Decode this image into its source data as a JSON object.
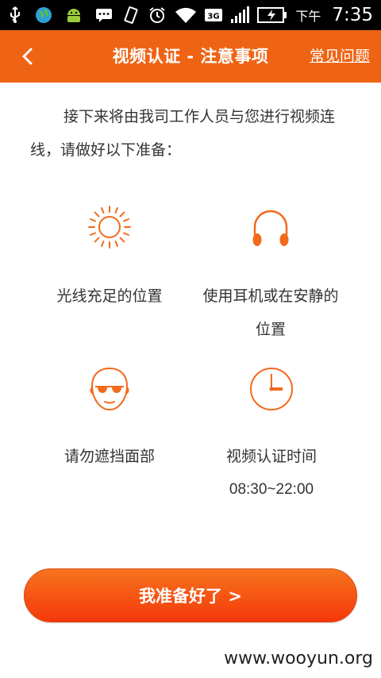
{
  "status_bar": {
    "icons": [
      "usb-icon",
      "globe-icon",
      "android-icon",
      "message-icon",
      "vibrate-icon",
      "alarm-icon",
      "wifi-icon",
      "network-3g-icon",
      "signal-icon",
      "battery-charging-icon"
    ],
    "network_label": "3G",
    "ampm": "下午",
    "time": "7:35"
  },
  "header": {
    "title": "视频认证 - 注意事项",
    "back_label": "<",
    "faq_label": "常见问题",
    "bg_color": "#ef6414"
  },
  "intro": {
    "text": "接下来将由我司工作人员与您进行视频连线，请做好以下准备："
  },
  "tips": [
    {
      "icon": "sun-icon",
      "label": "光线充足的位置",
      "sub": ""
    },
    {
      "icon": "headphones-icon",
      "label": "使用耳机或在安静的",
      "sub": "位置"
    },
    {
      "icon": "face-sunglasses-icon",
      "label": "请勿遮挡面部",
      "sub": ""
    },
    {
      "icon": "clock-icon",
      "label": "视频认证时间",
      "sub": "08:30~22:00"
    }
  ],
  "cta": {
    "label": "我准备好了 >"
  },
  "watermark": "www.wooyun.org",
  "colors": {
    "accent": "#ef6414",
    "icon": "#f26a1b"
  }
}
